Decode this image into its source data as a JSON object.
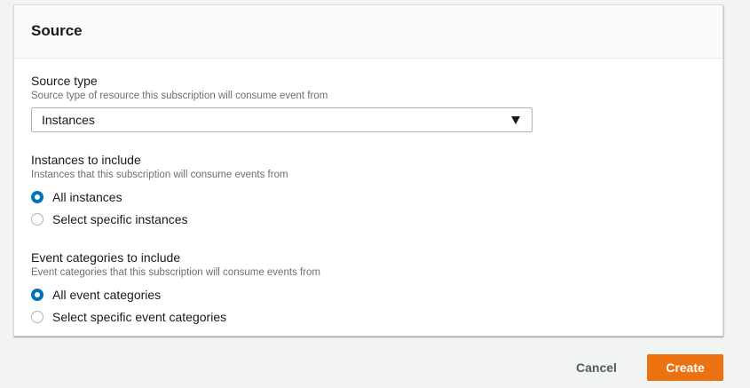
{
  "panel": {
    "title": "Source"
  },
  "source_type": {
    "label": "Source type",
    "description": "Source type of resource this subscription will consume event from",
    "selected": "Instances"
  },
  "instances": {
    "label": "Instances to include",
    "description": "Instances that this subscription will consume events from",
    "options": [
      {
        "label": "All instances",
        "checked": true
      },
      {
        "label": "Select specific instances",
        "checked": false
      }
    ]
  },
  "event_categories": {
    "label": "Event categories to include",
    "description": "Event categories that this subscription will consume events from",
    "options": [
      {
        "label": "All event categories",
        "checked": true
      },
      {
        "label": "Select specific event categories",
        "checked": false
      }
    ]
  },
  "footer": {
    "cancel_label": "Cancel",
    "create_label": "Create"
  },
  "colors": {
    "accent": "#0073bb",
    "primary_button": "#ec7211"
  },
  "icons": {
    "dropdown": "caret-down-icon"
  }
}
